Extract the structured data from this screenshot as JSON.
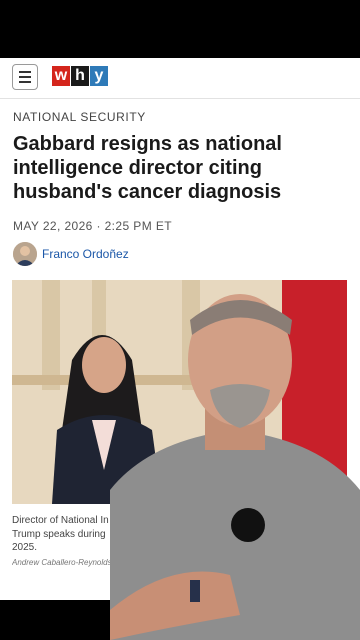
{
  "header": {
    "menu_icon": "hamburger-menu-icon",
    "logo_letters": [
      "w",
      "h",
      "y"
    ],
    "logo_colors": [
      "#d4251c",
      "#1a1a1a",
      "#2e7ab8"
    ]
  },
  "article": {
    "section": "NATIONAL SECURITY",
    "headline": "Gabbard resigns as national intelligence director citing husband's cancer diagnosis",
    "dateline": "MAY 22, 2026 · 2:25 PM ET",
    "author": "Franco Ordoñez",
    "caption_lines": [
      "Director of National In",
      "Trump speaks during",
      "2025."
    ],
    "photo_credit": "Andrew Caballero-Reynolds"
  },
  "colors": {
    "link": "#1b57a8",
    "flag_red": "#c8202a"
  }
}
